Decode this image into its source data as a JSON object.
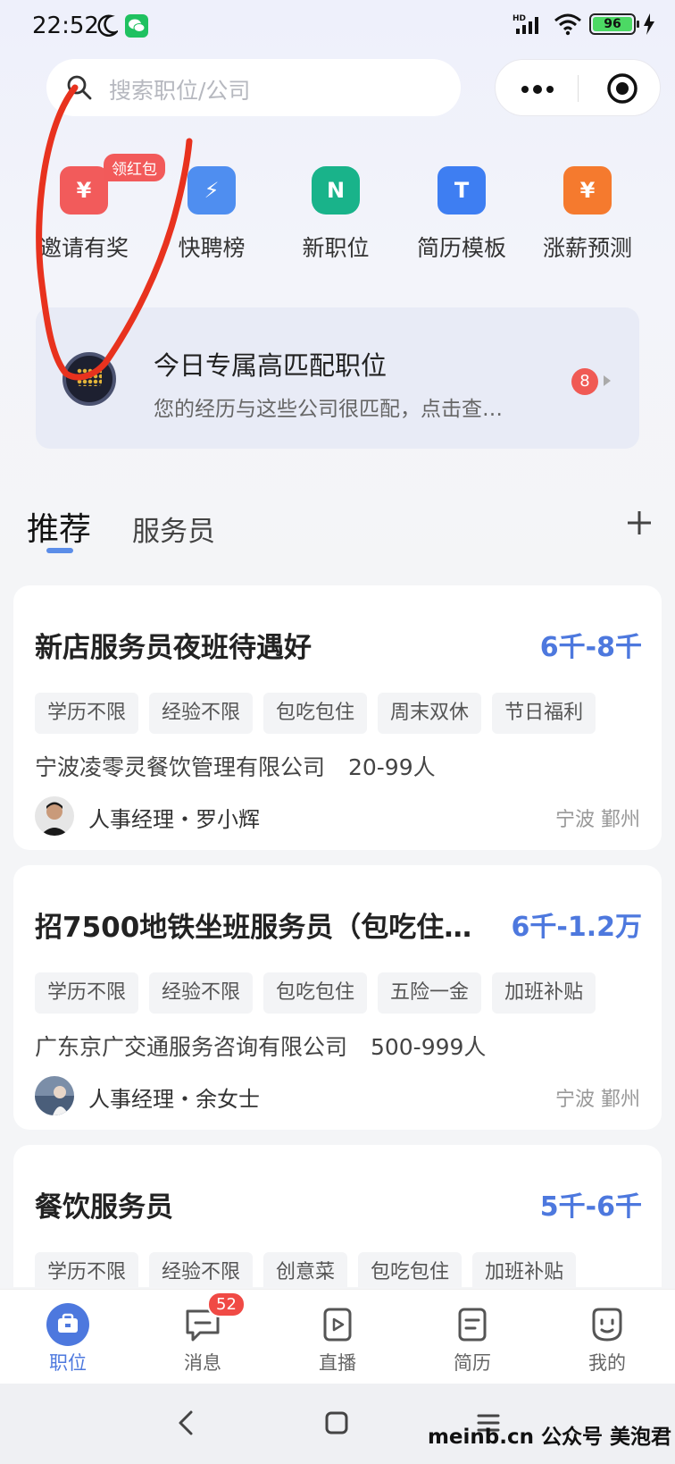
{
  "status_bar": {
    "time": "22:52",
    "battery": "96",
    "network_hd": "HD"
  },
  "search": {
    "placeholder": "搜索职位/公司"
  },
  "quick_entries": [
    {
      "label": "邀请有奖",
      "icon": "red-envelope-icon",
      "badge": "领红包",
      "color": "#f25b5b",
      "glyph": "¥"
    },
    {
      "label": "快聘榜",
      "icon": "lightning-icon",
      "color": "#4f8ef0",
      "glyph": "⚡"
    },
    {
      "label": "新职位",
      "icon": "new-job-icon",
      "color": "#19b38a",
      "glyph": "N"
    },
    {
      "label": "简历模板",
      "icon": "resume-template-icon",
      "color": "#3e7ef2",
      "glyph": "T"
    },
    {
      "label": "涨薪预测",
      "icon": "salary-forecast-icon",
      "color": "#f57a2e",
      "glyph": "¥"
    }
  ],
  "match_card": {
    "title": "今日专属高匹配职位",
    "subtitle": "您的经历与这些公司很匹配，点击查…",
    "count": "8"
  },
  "tabs": {
    "active": "推荐",
    "other": "服务员"
  },
  "jobs": [
    {
      "title": "新店服务员夜班待遇好",
      "salary": "6千-8千",
      "tags": [
        "学历不限",
        "经验不限",
        "包吃包住",
        "周末双休",
        "节日福利"
      ],
      "company": "宁波凌零灵餐饮管理有限公司",
      "size": "20-99人",
      "recruiter": "人事经理・罗小辉",
      "location": "宁波 鄞州"
    },
    {
      "title": "招7500地铁坐班服务员（包吃住…",
      "salary": "6千-1.2万",
      "tags": [
        "学历不限",
        "经验不限",
        "包吃包住",
        "五险一金",
        "加班补贴"
      ],
      "company": "广东京广交通服务咨询有限公司",
      "size": "500-999人",
      "recruiter": "人事经理・余女士",
      "location": "宁波 鄞州"
    },
    {
      "title": "餐饮服务员",
      "salary": "5千-6千",
      "tags": [
        "学历不限",
        "经验不限",
        "创意菜",
        "包吃包住",
        "加班补贴"
      ]
    }
  ],
  "bottom_nav": [
    {
      "label": "职位",
      "icon": "briefcase-icon",
      "active": true
    },
    {
      "label": "消息",
      "icon": "message-icon",
      "badge": "52"
    },
    {
      "label": "直播",
      "icon": "live-icon"
    },
    {
      "label": "简历",
      "icon": "resume-icon"
    },
    {
      "label": "我的",
      "icon": "profile-icon"
    }
  ],
  "watermark": "meinb.cn 公众号 美泡君",
  "colors": {
    "accent": "#4d78de",
    "badge_red": "#f04a45",
    "annotation_red": "#e8321e"
  }
}
